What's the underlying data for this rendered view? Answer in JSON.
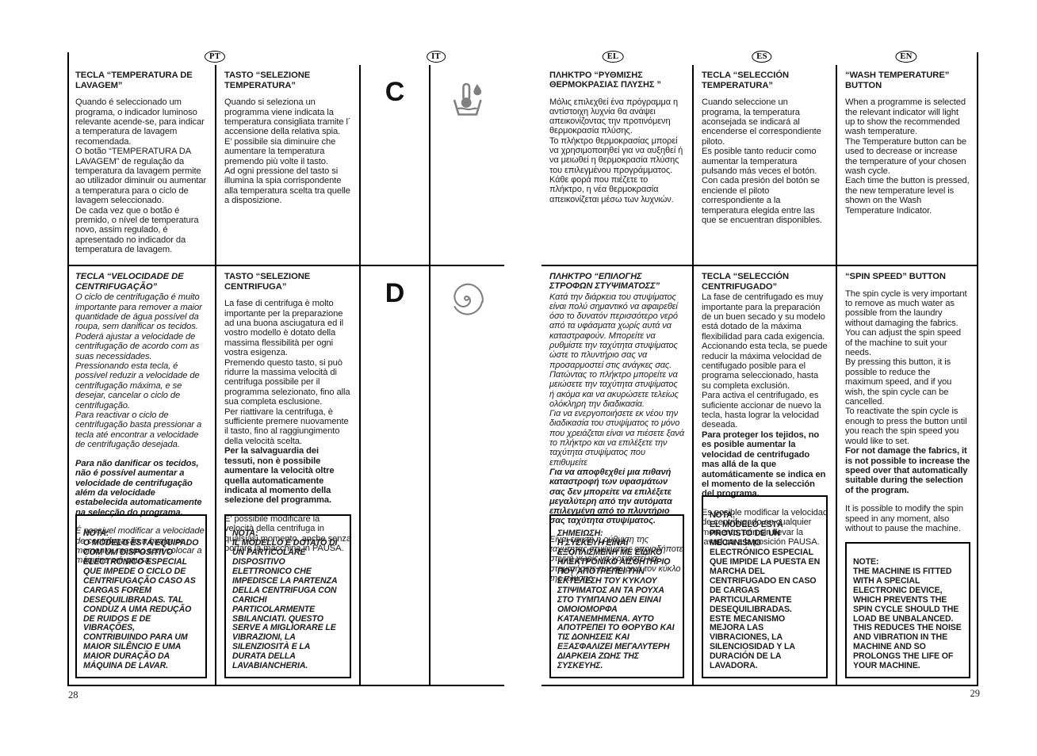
{
  "pages": {
    "left_number": "28",
    "right_number": "29"
  },
  "flags": {
    "pt": "PT",
    "it": "IT",
    "el": "EL",
    "es": "ES",
    "en": "EN"
  },
  "markers": {
    "row_c": "C",
    "row_d": "D",
    "icon_c": "wash-temperature-icon",
    "icon_d": "spin-speed-spiral-icon"
  },
  "row_c": {
    "pt": {
      "title": "TECLA “TEMPERATURA DE LAVAGEM”",
      "body": "Quando é seleccionado um programa, o indicador luminoso relevante acende-se, para indicar a temperatura de lavagem recomendada.\nO botão “TEMPERATURA DA LAVAGEM” de regulação da temperatura da lavagem permite ao utilizador diminuir ou aumentar a temperatura para o ciclo de lavagem seleccionado.\nDe cada vez que o botão é premido, o nível de temperatura novo, assim regulado, é apresentado no indicador da temperatura de lavagem."
    },
    "it": {
      "title": "TASTO “SELEZIONE TEMPERATURA”",
      "body": "Quando si seleziona un programma viene indicata la temperatura consigliata tramite l´ accensione della relativa spia.\nE’ possibile sia diminuire che aumentare la temperatura premendo più volte il tasto.\nAd ogni pressione del tasto si illumina la spia corrispondente alla temperatura scelta tra quelle a disposizione."
    },
    "el": {
      "title": "ΠΛΗΚΤΡΟ “ΡΥΘΜΙΣΗΣ ΘΕΡΜΟΚΡΑΣΙΑΣ ΠΛΥΣΗΣ ”",
      "body": "Μόλις επιλεχθεί ένα πρόγραμμα η αντίστοιχη λυχνία θα ανάψει απεικονίζοντας την προτινόμενη θερμοκρασία πλύσης.\nΤο πλήκτρο θερμοκρασίας μπορεί να χρησιμοποιηθεί για να αυξηθεί ή να μειωθεί η θερμοκρασία πλύσης του επιλεγμένου προγράμματος.\nΚάθε φορά που πιέζετε το πλήκτρο, η νέα θερμοκρασία απεικονίζεται μέσω των λυχνιών."
    },
    "es": {
      "title": "TECLA “SELECCIÓN TEMPERATURA”",
      "body": "Cuando seleccione un programa, la temperatura aconsejada se indicará al encenderse el correspondiente piloto.\nEs posible tanto reducir como aumentar la temperatura pulsando más veces el botón.\nCon cada presión del botón se enciende el piloto correspondiente a la temperatura elegida entre las que se encuentran disponibles."
    },
    "en": {
      "title": "“WASH TEMPERATURE” BUTTON",
      "body": "When a programme is selected the relevant indicator will light up to show the recommended wash temperature.\nThe Temperature button can be used to decrease or increase the temperature of your chosen wash cycle.\nEach time the button is pressed, the new temperature level is shown on the Wash Temperature Indicator."
    }
  },
  "row_d": {
    "pt": {
      "title": "TECLA “VELOCIDADE DE CENTRIFUGAÇÃO”",
      "body": "O ciclo de centrifugação é muito importante para remover a maior quantidade de água possível da roupa, sem danificar os tecidos. Poderá ajustar a velocidade de centrifugação de acordo com as suas necessidades.\nPressionando esta tecla, é possível reduzir a velocidade de centrifugação máxima, e se desejar, cancelar o ciclo de centrifugação.\nPara reactivar o ciclo de centrifugação basta pressionar a tecla até encontrar a velocidade de centrifugação desejada.",
      "bold": "Para não danificar os tecidos, não é possível aumentar a velocidade de centrifugação além da velocidade estabelecida automaticamente na selecção do programa.",
      "tail": "É possível modificar a velocidade de centrifugação a qualquer momento, mesmo sem colocar a máquina em pausa.",
      "note_label": "NOTA:",
      "note": "O MODELO ESTÁ  EQUIPADO COM UM DISPOSITIVO ELECTRÓNICO ESPECIAL QUE IMPEDE O CICLO DE CENTRIFUGAÇÃO CASO AS CARGAS FOREM DESEQUILIBRADAS. TAL CONDUZ A UMA REDUÇÃO DE RUIDOS E DE VIBRAÇÕES, CONTRIBUINDO PARA UM MAIOR SILÊNCIO E UMA MAIOR DURAÇÃO DA MÁQUINA DE LAVAR."
    },
    "it": {
      "title": "TASTO “SELEZIONE CENTRIFUGA”",
      "body": "La fase di centrifuga è molto importante per la preparazione ad una buona asciugatura ed il vostro modello è dotato della massima flessibilità per ogni vostra esigenza.\nPremendo questo tasto, si può ridurre la massima velocità di centrifuga possibile per il programma selezionato, fino alla sua completa esclusione.\nPer riattivare la centrifuga, è sufficiente premere nuovamente il tasto, fino al raggiungimento della velocità scelta.",
      "bold": "Per la salvaguardia dei tessuti, non è possibile aumentare la velocità oltre quella automaticamente indicata al momento della selezione del programma.",
      "tail": "E' possibile modificare la velocità della centrifuga in qualsiasi momento, anche senza portare la macchina in PAUSA.",
      "note_label": "NOTA:",
      "note": "IL MODELLO È DOTATO DI UN PARTICOLARE DISPOSITIVO ELETTRONICO CHE IMPEDISCE LA PARTENZA DELLA CENTRIFUGA CON CARICHI PARTICOLARMENTE SBILANCIATI. QUESTO SERVE A MIGLIORARE LE VIBRAZIONI, LA SILENZIOSITÀ E LA DURATA DELLA LAVABIANCHERIA."
    },
    "el": {
      "title": "ΠΛΗΚΤΡΟ “ΕΠΙΛΟΓΗΣ ΣΤΡΟΦΩΝ ΣΤΥΨΙΜΑΤΟΣΣ”",
      "body": "Κατά την διάρκεια του στυψίματος είναι πολύ σημαντικό να αφαιρεθεί όσο το δυνατόν περισσότερο νερό από τα υφάσματα χωρίς αυτά να καταστραφούν. Μπορείτε να ρυθμίστε την ταχύτητα στυψίματος ώστε το πλυντήριο σας να προσαρμοστεί στις ανάγκες σας.\nΠατώντας το πλήκτρο μπορείτε να μειώσετε την ταχύτητα στυψίματος ή ακόμα και να ακυρώσετε τελείως ολόκληρη την διαδικασία.\nΓια να ενεργοποιήσετε εκ νέου την διαδικασία του στυψίματος το μόνο που χρειάζεται είναι να πιέσετε ξανά το πλήκτρο και να επιλέξετε την ταχύτητα στυψίματος που επιθυμείτε",
      "bold": "Για να αποφθεχθεί μια πιθανή καταστροφή των υφασμάτων σας δεν μπορείτε να επιλέξετε μεγαλύτερη από την αυτόματα επιλεγμένη από το πλυντήριο σας ταχύτητα στυψίματος.",
      "tail": "Είναι εφικτή η ρύθμιση της ταχύτητας στυψίματος οποιαδήποτε στιγμή χωρίς να χρειαστεί να σταματήσετε προσωρινά τον κύκλο της πλύσης.",
      "note_label": "ΣΗΜΕΙΩΣΗ:",
      "note": "Η ΣΥΣΚΕΥΗ ΕΙΝΑΙ ΕΞΟΠΛΙΣΜΕΝΗ ΜΕ ΕΙΔΙΚΟ ΗΛΕΚΤΡΟΝΙΚΟ ΑΙΣΘΗΤΗΡΙΟ ΠΟΥ ΑΠΟΤΡΕΠΕΙ ΤΗΝ ΕΚΤΕΛΕΣΗ ΤΟΥ ΚΥΚΛΟΥ ΣΤΙΨΙΜΑΤΟΣ ΑΝ ΤΑ ΡΟΥΧΑ ΣΤΟ ΤΥΜΠΑΝΟ ΔΕΝ ΕΙΝΑΙ ΟΜΟΙΟΜΟΡΦΑ ΚΑΤΑΝΕΜΗΜΕΝΑ. ΑΥΤΟ ΑΠΟΤΡΕΠΕΙ ΤΟ ΘΟΡΥΒΟ ΚΑΙ ΤΙΣ ΔΟΝΗΣΕΙΣ ΚΑΙ ΕΞΑΣΦΑΛΙΖΕΙ ΜΕΓΑΛΥΤΕΡΗ ΔΙΑΡΚΕΙΑ ΖΩΗΣ ΤΗΣ ΣΥΣΚΕΥΗΣ."
    },
    "es": {
      "title": "TECLA “SELECCIÓN CENTRIFUGADO”",
      "body": "La fase de  centrifugado es muy importante para la preparación de un buen secado y su modelo está dotado de la máxima flexibilidad para cada exigencia. Accionando esta tecla, se puede reducir la máxima velocidad de centifugado posible para el programa seleccionado, hasta su completa exclusión.\nPara activa el centrifugado, es suficiente accionar de nuevo la tecla, hasta lograr la velocidad deseada.",
      "bold": "Para proteger los tejidos, no es posible aumentar la velocidad de centrifugado mas allá de la que automáticamente se indica en el momento de la selección del programa.",
      "tail": "Es posible modificar la velocidad de centrifugado en cualquier momento, aún sin llevar la lavadora a la posición PAUSA.",
      "note_label": "NOTA:",
      "note": "EL MODELO ESTÁ PROVISTO DE UN MECANISMO ELECTRÓNICO ESPECIAL QUE IMPIDE LA PUESTA EN MARCHA DEL CENTRIFUGADO EN CASO DE CARGAS PARTICULARMENTE DESEQUILIBRADAS.\nESTE MECANISMO MEJORA LAS VIBRACIONES, LA SILENCIOSIDAD Y LA DURACIÓN DE LA LAVADORA."
    },
    "en": {
      "title": "“SPIN SPEED” BUTTON",
      "body": "The spin cycle is very important to remove as much water as possible from the laundry without damaging the fabrics. You can adjust the spin speed of the machine to suit your needs.\nBy pressing this button, it is possible to reduce the maximum speed, and if you wish, the spin cycle can be cancelled.\nTo reactivate the spin cycle is enough to press the button until you reach the spin speed you would like to set.",
      "bold": "For not damage the fabrics, it is not possible to increase the speed over that automatically suitable during the selection of the program.",
      "tail": "It is possible to modify the spin speed in any moment, also without to pause the machine.",
      "note_label": "NOTE:",
      "note": "THE MACHINE IS FITTED WITH A SPECIAL ELECTRONIC DEVICE, WHICH PREVENTS THE SPIN CYCLE SHOULD THE LOAD BE UNBALANCED.\nTHIS REDUCES THE NOISE AND VIBRATION IN THE MACHINE AND SO PROLONGS THE LIFE OF YOUR MACHINE."
    }
  },
  "colors": {
    "rule": "#000000",
    "icon": "#808080",
    "text": "#1a1a1a"
  }
}
